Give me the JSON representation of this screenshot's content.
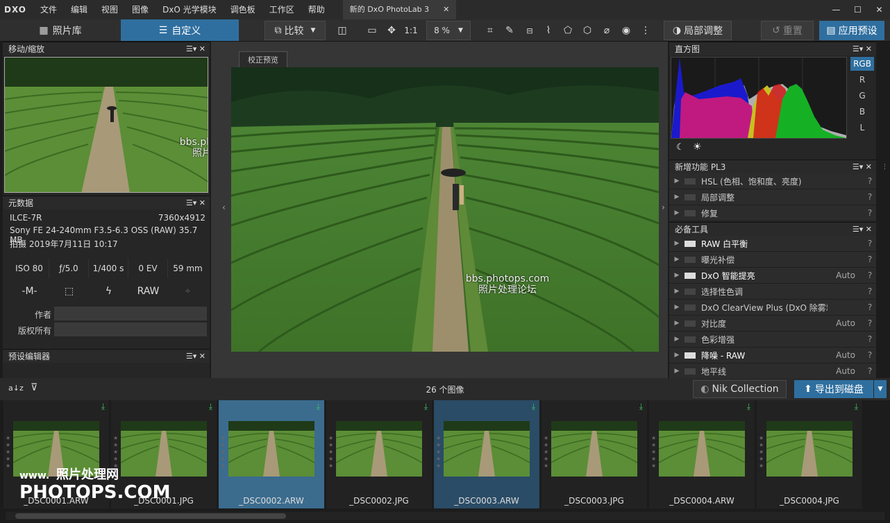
{
  "menubar": {
    "logo": "DXO",
    "items": [
      "文件",
      "编辑",
      "视图",
      "图像",
      "DxO 光学模块",
      "调色板",
      "工作区",
      "帮助"
    ],
    "doc_tab": "新的 DxO PhotoLab 3",
    "doc_tab_close": "✕",
    "window_controls": [
      "—",
      "☐",
      "✕"
    ]
  },
  "toolbar": {
    "tabs": [
      "照片库",
      "自定义"
    ],
    "compare": "比较",
    "zoom_fit": "1:1",
    "zoom_value": "8 %",
    "local_adjust": "局部调整",
    "reset": "重置",
    "apply_preset": "应用预设"
  },
  "left": {
    "navigator_title": "移动/缩放",
    "metadata_title": "元数据",
    "camera": "ILCE-7R",
    "dimensions": "7360x4912",
    "lens_info": "Sony FE 24-240mm F3.5-6.3 OSS (RAW)  35.7 MB",
    "shot_date": "拍摄 2019年7月11日 10:17",
    "exif": [
      "ISO 80",
      "ƒ/5.0",
      "1/400 s",
      "0 EV",
      "59 mm"
    ],
    "exif2": [
      "-M-",
      "⬚",
      "ϟ",
      "RAW",
      "⌖"
    ],
    "author_label": "作者",
    "copyright_label": "版权所有",
    "preset_editor_title": "预设编辑器",
    "panel_ctrl": "☰▾ ✕"
  },
  "center": {
    "preview_label": "校正预览",
    "watermark_url": "bbs.photops.com",
    "watermark_text": "照片处理论坛"
  },
  "right": {
    "histogram_title": "直方图",
    "channels": [
      "RGB",
      "R",
      "G",
      "B",
      "L"
    ],
    "new_features_title": "新增功能 PL3",
    "new_features": [
      {
        "name": "HSL (色相、饱和度、亮度)",
        "val": "",
        "on": false
      },
      {
        "name": "局部调整",
        "val": "",
        "on": false
      },
      {
        "name": "修复",
        "val": "",
        "on": false
      }
    ],
    "essential_title": "必备工具",
    "essential": [
      {
        "name": "RAW 白平衡",
        "val": "",
        "on": true
      },
      {
        "name": "曝光补偿",
        "val": "",
        "on": false
      },
      {
        "name": "DxO 智能提亮",
        "val": "Auto",
        "on": true
      },
      {
        "name": "选择性色调",
        "val": "",
        "on": false
      },
      {
        "name": "DxO ClearView Plus (DxO 除雾增强)",
        "val": "",
        "on": false
      },
      {
        "name": "对比度",
        "val": "Auto",
        "on": false
      },
      {
        "name": "色彩增强",
        "val": "",
        "on": false
      },
      {
        "name": "降噪 - RAW",
        "val": "Auto",
        "on": true
      },
      {
        "name": "地平线",
        "val": "Auto",
        "on": false
      }
    ],
    "q": "?"
  },
  "filmbar": {
    "sort": "a↓z",
    "filter": "⊽",
    "count": "26 个图像",
    "nik": "Nik Collection",
    "export": "导出到磁盘"
  },
  "filmstrip": [
    {
      "name": "_DSC0001.ARW",
      "state": ""
    },
    {
      "name": "_DSC0001.JPG",
      "state": ""
    },
    {
      "name": "_DSC0002.ARW",
      "state": "sel"
    },
    {
      "name": "_DSC0002.JPG",
      "state": ""
    },
    {
      "name": "_DSC0003.ARW",
      "state": "sel2"
    },
    {
      "name": "_DSC0003.JPG",
      "state": ""
    },
    {
      "name": "_DSC0004.ARW",
      "state": ""
    },
    {
      "name": "_DSC0004.JPG",
      "state": ""
    }
  ],
  "watermark_site": {
    "line1": "www.",
    "line1b": "照片处理网",
    "line2": "PHOTOPS.COM"
  }
}
